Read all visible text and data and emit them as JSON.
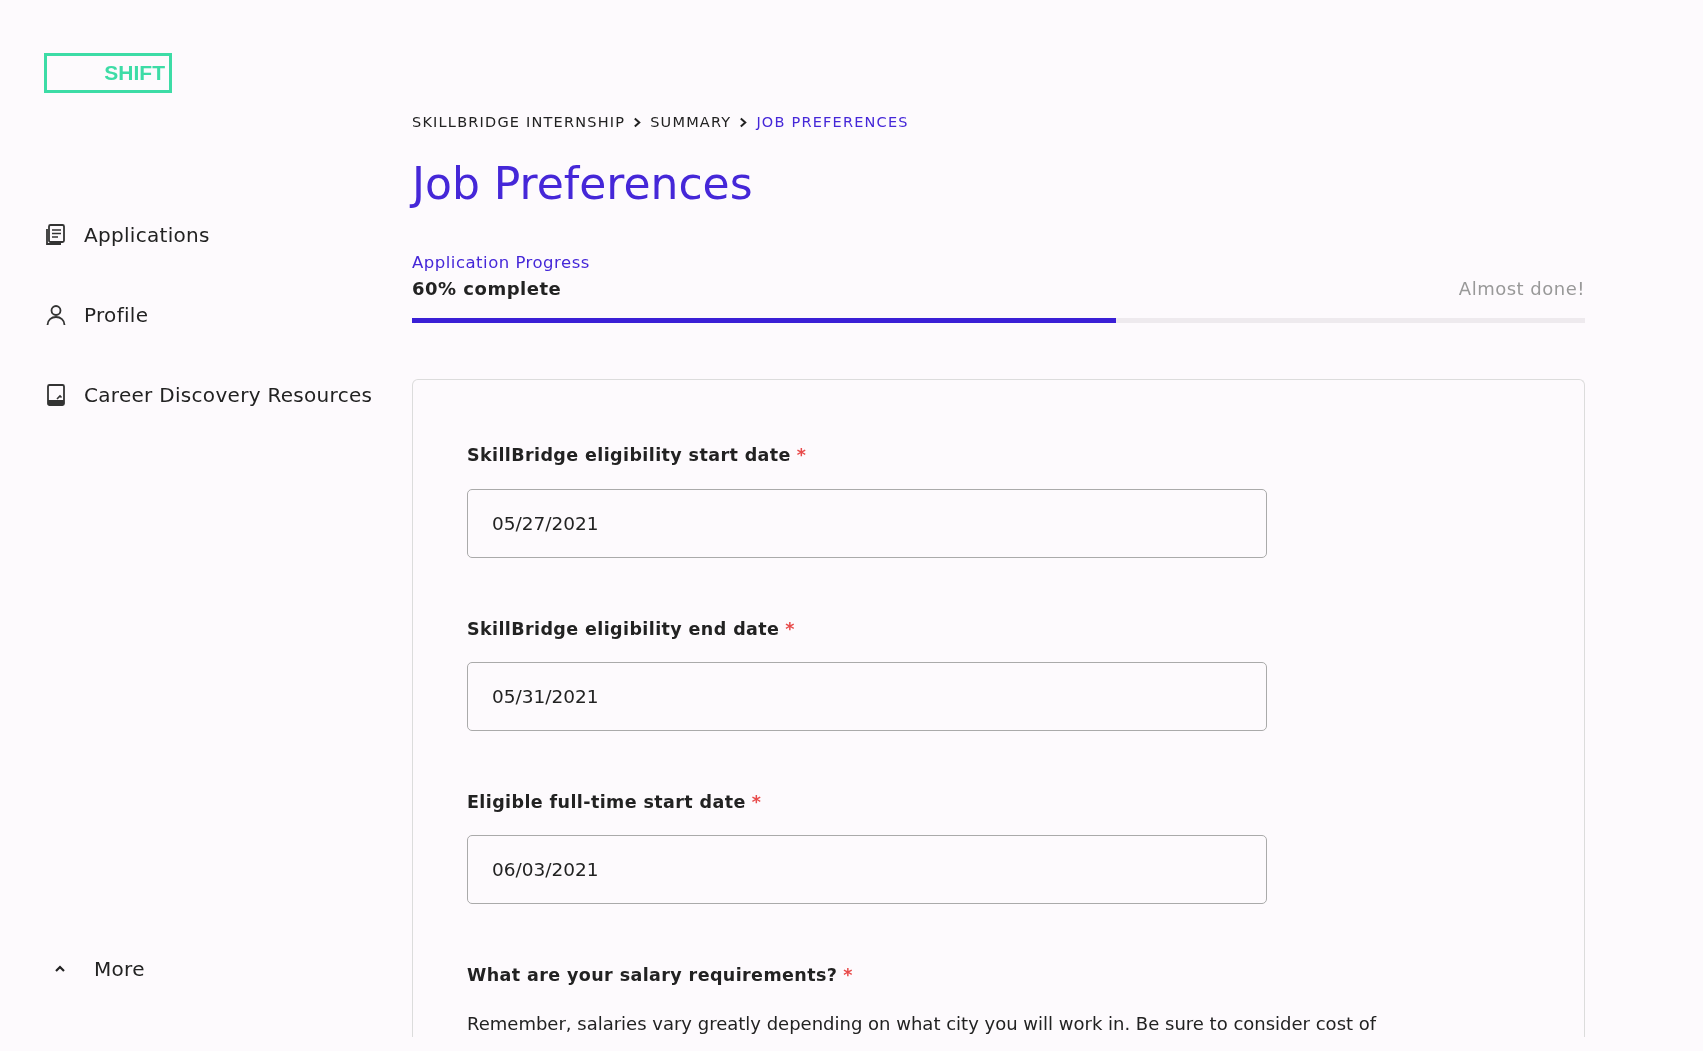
{
  "logo": {
    "text": "SHIFT"
  },
  "sidebar": {
    "items": [
      {
        "label": "Applications"
      },
      {
        "label": "Profile"
      },
      {
        "label": "Career Discovery Resources"
      }
    ],
    "more": {
      "label": "More",
      "expanded": true
    }
  },
  "breadcrumb": [
    {
      "label": "SKILLBRIDGE INTERNSHIP",
      "selected": false
    },
    {
      "label": "SUMMARY",
      "selected": false
    },
    {
      "label": "JOB PREFERENCES",
      "selected": true
    }
  ],
  "title": "Job Preferences",
  "progress": {
    "label": "Application Progress",
    "status": "60% complete",
    "note": "Almost done!",
    "level": 0.6
  },
  "form": {
    "fields": [
      {
        "label": "SkillBridge eligibility start date",
        "required_mark": "*",
        "value": "05/27/2021"
      },
      {
        "label": "SkillBridge eligibility end date",
        "required_mark": "*",
        "value": "05/31/2021"
      },
      {
        "label": "Eligible full-time start date",
        "required_mark": "*",
        "value": "06/03/2021"
      }
    ],
    "question": {
      "label": "What are your salary requirements?",
      "required_mark": "*",
      "help": "Remember, salaries vary greatly depending on what city you will work in. Be sure to consider cost of"
    }
  }
}
